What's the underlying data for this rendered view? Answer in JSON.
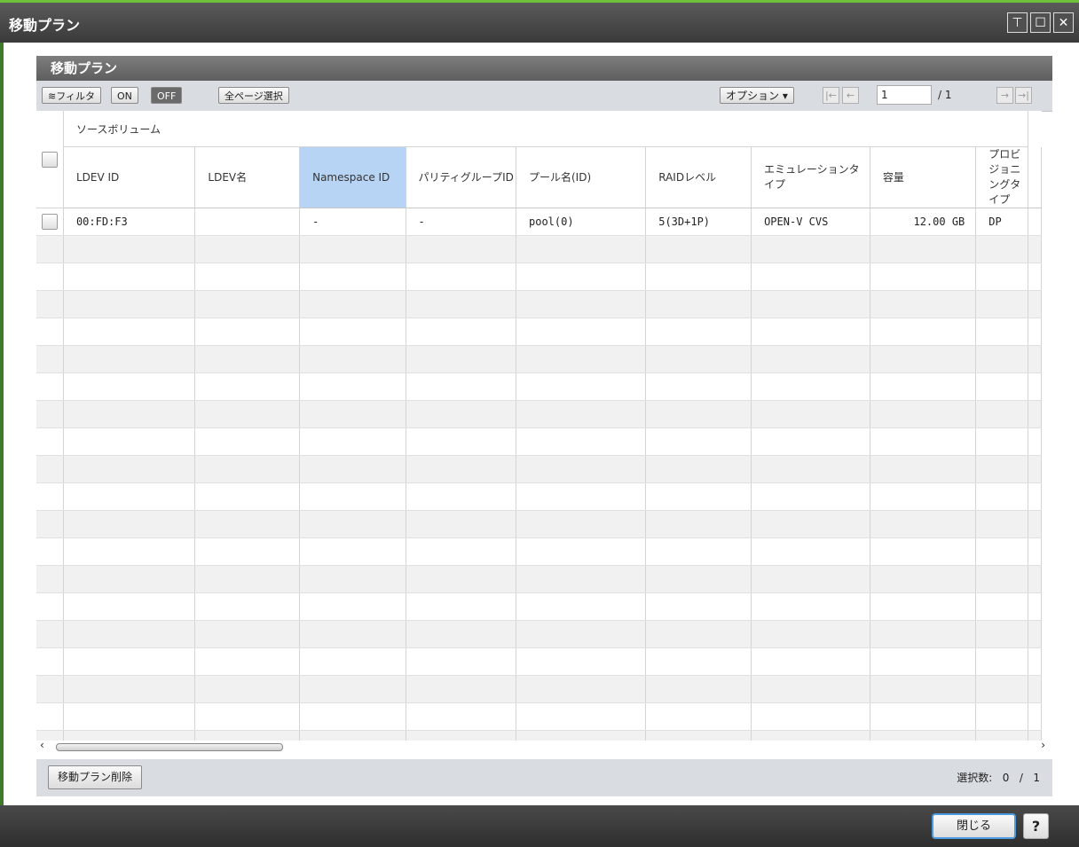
{
  "window": {
    "title": "移動プラン",
    "icons": {
      "restore": "pin-icon",
      "maximize": "maximize-icon",
      "close": "close-icon"
    }
  },
  "panel": {
    "title": "移動プラン"
  },
  "toolbar": {
    "filter_label": "≋フィルタ",
    "on_label": "ON",
    "off_label": "OFF",
    "select_all_label": "全ページ選択",
    "options_label": "オプション ▾",
    "page_current": "1",
    "page_total": "/ 1",
    "nav_icons": [
      "first-page-icon",
      "prev-page-icon",
      "next-page-icon",
      "last-page-icon"
    ]
  },
  "table": {
    "group_header": "ソースボリューム",
    "columns": [
      "LDEV ID",
      "LDEV名",
      "Namespace ID",
      "パリティグループID",
      "プール名(ID)",
      "RAIDレベル",
      "エミュレーションタイプ",
      "容量",
      "プロビジョニングタイプ"
    ],
    "rows": [
      [
        "00:FD:F3",
        "",
        "-",
        "-",
        "pool(0)",
        "5(3D+1P)",
        "OPEN-V CVS",
        "12.00 GB",
        "DP"
      ]
    ],
    "empty_row_count": 20
  },
  "footer": {
    "delete_label": "移動プラン削除",
    "selection_label": "選択数:",
    "selected": "0",
    "total": "1"
  },
  "bottom": {
    "close_label": "閉じる",
    "help_label": "?"
  },
  "colors": {
    "accent": "#6fc13a",
    "selected_header": "#b8d4f4",
    "focus_border": "#4c9be0"
  }
}
